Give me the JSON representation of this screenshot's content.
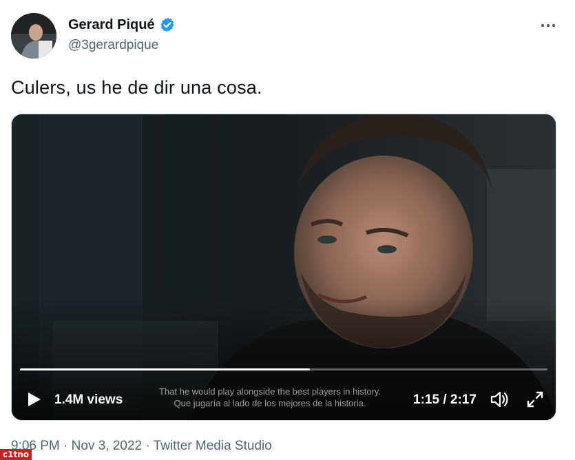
{
  "author": {
    "display_name": "Gerard Piqué",
    "handle": "@3gerardpique",
    "verified": true
  },
  "tweet": {
    "text": "Culers, us he de dir una cosa.",
    "timestamp": "9:06 PM",
    "separator": "·",
    "date": "Nov 3, 2022",
    "source": "Twitter Media Studio"
  },
  "video": {
    "views": "1.4M views",
    "current_time": "1:15",
    "time_separator": "/",
    "duration": "2:17",
    "progress_fraction": 0.55,
    "caption_line_1": "That he would play alongside the best players in history.",
    "caption_line_2": "Que jugaría al lado de los mejores de la historia."
  },
  "watermark": {
    "text": "c1tno"
  },
  "icons": {
    "verified": "verified-badge-icon",
    "more": "more-horizontal-icon",
    "play": "play-icon",
    "volume": "volume-icon",
    "fullscreen": "fullscreen-icon"
  },
  "colors": {
    "verified_blue": "#1d9bf0",
    "secondary_text": "#536471",
    "primary_text": "#0f1419"
  }
}
